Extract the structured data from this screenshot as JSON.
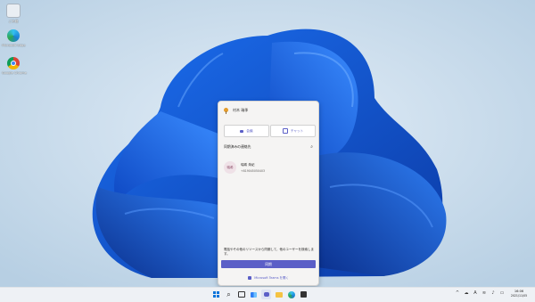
{
  "desktop": {
    "icons": [
      {
        "label": "ごみ箱",
        "icon": "recycle-bin-icon"
      },
      {
        "label": "Microsoft Edge",
        "icon": "edge-icon"
      },
      {
        "label": "Google Chrome",
        "icon": "chrome-icon"
      }
    ]
  },
  "teams_flyout": {
    "user_name": "村木 瑞季",
    "meet_label": "会議",
    "chat_label": "チャット",
    "section_title": "同期済みの連絡先",
    "contact": {
      "avatar_text": "瑞希",
      "name": "瑞希 朱紀",
      "phone": "+819045050403"
    },
    "footer_text": "電話やその他のリソースから同期して、他のユーザーを検索します。",
    "primary_button_label": "同期",
    "open_teams_label": "Microsoft Teams を開く",
    "colors": {
      "accent": "#5b5fc7"
    }
  },
  "taskbar": {
    "apps": [
      "windows-start-icon",
      "search-icon",
      "task-view-icon",
      "widgets-icon",
      "chat-icon",
      "file-explorer-icon",
      "edge-icon",
      "store-icon"
    ],
    "time": "16:06",
    "date": "2021/11/05"
  }
}
